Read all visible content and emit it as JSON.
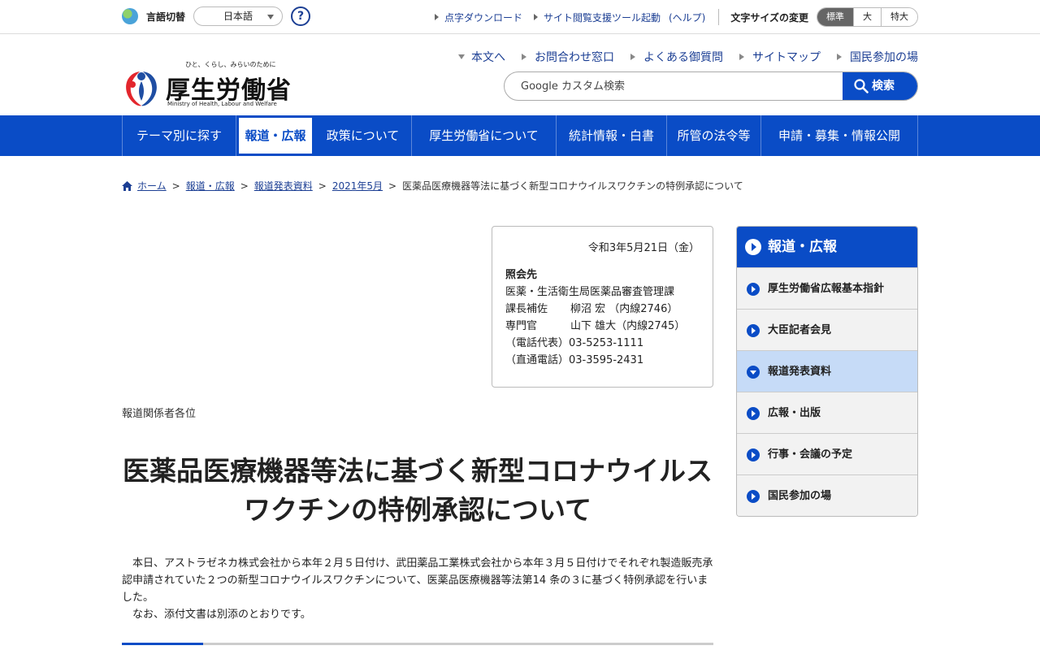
{
  "utility": {
    "lang_label": "言語切替",
    "lang_selected": "日本語",
    "help_label": "?",
    "links": [
      "点字ダウンロード",
      "サイト閲覧支援ツール起動",
      "(ヘルプ)"
    ],
    "font_size_label": "文字サイズの変更",
    "font_sizes": [
      "標準",
      "大",
      "特大"
    ]
  },
  "header": {
    "logo_tagline": "ひと、くらし、みらいのために",
    "logo_text": "厚生労働省",
    "logo_english": "Ministry of Health, Labour and Welfare",
    "links": [
      "本文へ",
      "お問合わせ窓口",
      "よくある御質問",
      "サイトマップ",
      "国民参加の場"
    ],
    "search_placeholder": "Google カスタム検索",
    "search_button": "検索"
  },
  "gnav": [
    "テーマ別に探す",
    "報道・広報",
    "政策について",
    "厚生労働省について",
    "統計情報・白書",
    "所管の法令等",
    "申請・募集・情報公開"
  ],
  "breadcrumb": {
    "items": [
      "ホーム",
      "報道・広報",
      "報道発表資料",
      "2021年5月"
    ],
    "current": "医薬品医療機器等法に基づく新型コロナウイルスワクチンの特例承認について"
  },
  "contact": {
    "date": "令和3年5月21日（金）",
    "title": "照会先",
    "dept": "医薬・生活衛生局医薬品審査管理課",
    "rows": [
      {
        "role": "課長補佐",
        "person": "柳沼 宏 （内線2746）"
      },
      {
        "role": "専門官",
        "person": "山下 雄大（内線2745）"
      }
    ],
    "phones": [
      "（電話代表）03-5253-1111",
      "（直通電話）03-3595-2431"
    ]
  },
  "article": {
    "addressee": "報道関係者各位",
    "title": "医薬品医療機器等法に基づく新型コロナウイルスワクチンの特例承認について",
    "paragraphs": [
      "本日、アストラゼネカ株式会社から本年２月５日付け、武田薬品工業株式会社から本年３月５日付けでそれぞれ製造販売承認申請されていた２つの新型コロナウイルスワクチンについて、医薬品医療機器等法第14 条の３に基づく特例承認を行いました。",
      "なお、添付文書は別添のとおりです。"
    ]
  },
  "sidenav": {
    "title": "報道・広報",
    "items": [
      "厚生労働省広報基本指針",
      "大臣記者会見",
      "報道発表資料",
      "広報・出版",
      "行事・会議の予定",
      "国民参加の場"
    ],
    "active_index": 2
  },
  "colors": {
    "brand_blue": "#0a4cc6",
    "link": "#1c3f94",
    "side_active": "#c6dbf7"
  }
}
